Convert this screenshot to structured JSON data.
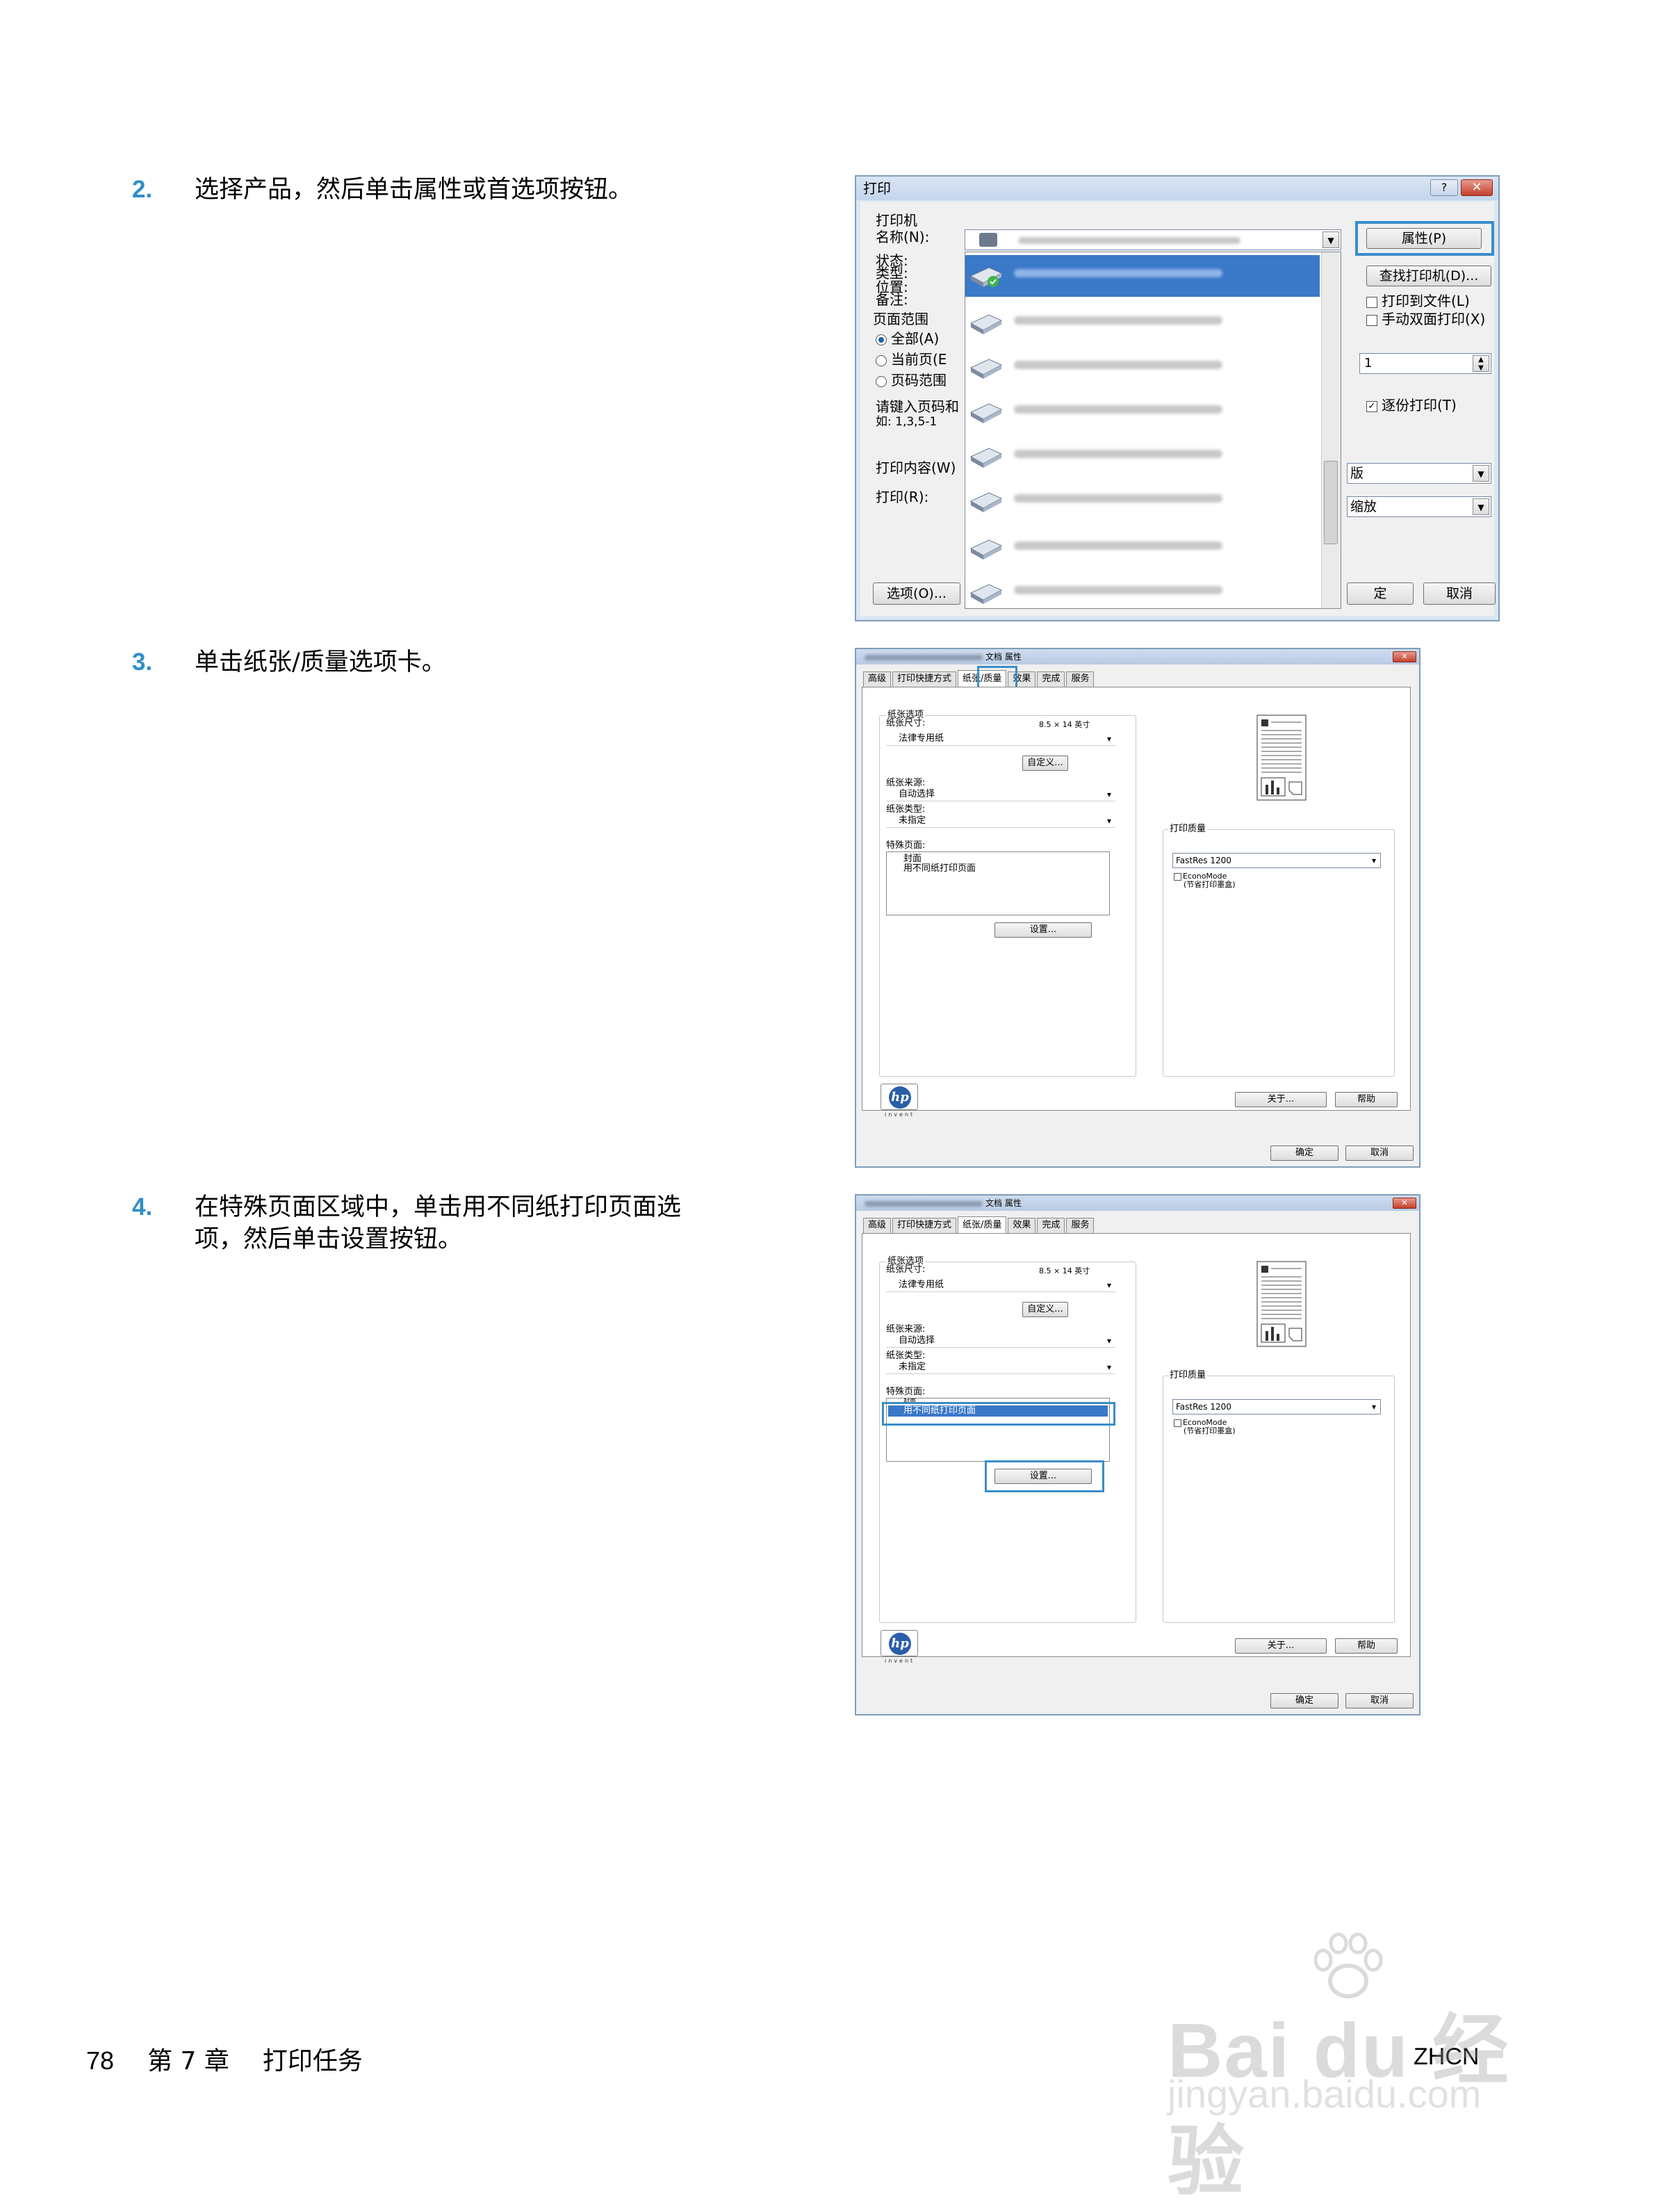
{
  "steps": [
    {
      "num": "2.",
      "text": "选择产品，然后单击属性或首选项按钮。"
    },
    {
      "num": "3.",
      "text": "单击纸张/质量选项卡。"
    },
    {
      "num": "4.",
      "text": "在特殊页面区域中，单击用不同纸打印页面选\n项，然后单击设置按钮。"
    }
  ],
  "print_dialog": {
    "title": "打印",
    "help_button": "?",
    "close_button": "✕",
    "group_printer": "打印机",
    "name_label": "名称(N):",
    "status_label": "状态:",
    "type_label": "类型:",
    "location_label": "位置:",
    "comment_label": "备注:",
    "range_label": "页面范围",
    "range_all": "全部(A)",
    "range_current": "当前页(E",
    "range_pages": "页码范围",
    "pages_hint1": "请键入页码和",
    "pages_hint2": "如: 1,3,5-1",
    "print_what_label": "打印内容(W)",
    "print_label": "打印(R):",
    "options_button": "选项(O)...",
    "properties_button": "属性(P)",
    "find_printer_button": "查找打印机(D)...",
    "print_to_file": "打印到文件(L)",
    "manual_duplex": "手动双面打印(X)",
    "copies_value": "1",
    "collate": "逐份打印(T)",
    "combo_layout": "版",
    "combo_zoom": "缩放",
    "ok_button": "定",
    "cancel_button": "取消"
  },
  "props_dialog": {
    "title_suffix": "文档 属性",
    "tabs": [
      "高级",
      "打印快捷方式",
      "纸张/质量",
      "效果",
      "完成",
      "服务"
    ],
    "paper_options": "纸张选项",
    "paper_size_label": "纸张尺寸:",
    "paper_size_value": "8.5 × 14 英寸",
    "paper_type_name": "法律专用纸",
    "custom_button": "自定义...",
    "paper_source_label": "纸张来源:",
    "paper_source_value": "自动选择",
    "paper_type_label": "纸张类型:",
    "paper_type_value": "未指定",
    "special_pages_label": "特殊页面:",
    "special_item_cover": "封面",
    "special_item_diff": "用不同纸打印页面",
    "settings_button": "设置...",
    "print_quality": "打印质量",
    "quality_value": "FastRes 1200",
    "econo_mode": "EconoMode",
    "econo_sub": "(节省打印墨盒)",
    "about_button": "关于...",
    "help_button": "帮助",
    "ok_button": "确定",
    "cancel_button": "取消",
    "hp_invent": "invent"
  },
  "footer": {
    "page_number": "78",
    "chapter": "第 7 章",
    "chapter_title": "打印任务",
    "locale": "ZHCN"
  },
  "watermark": {
    "logo": "Bai du 经验",
    "url": "jingyan.baidu.com"
  },
  "colors": {
    "step_number": "#2f8fc9",
    "highlight": "#3a8ec8",
    "selection": "#3a78c8"
  }
}
